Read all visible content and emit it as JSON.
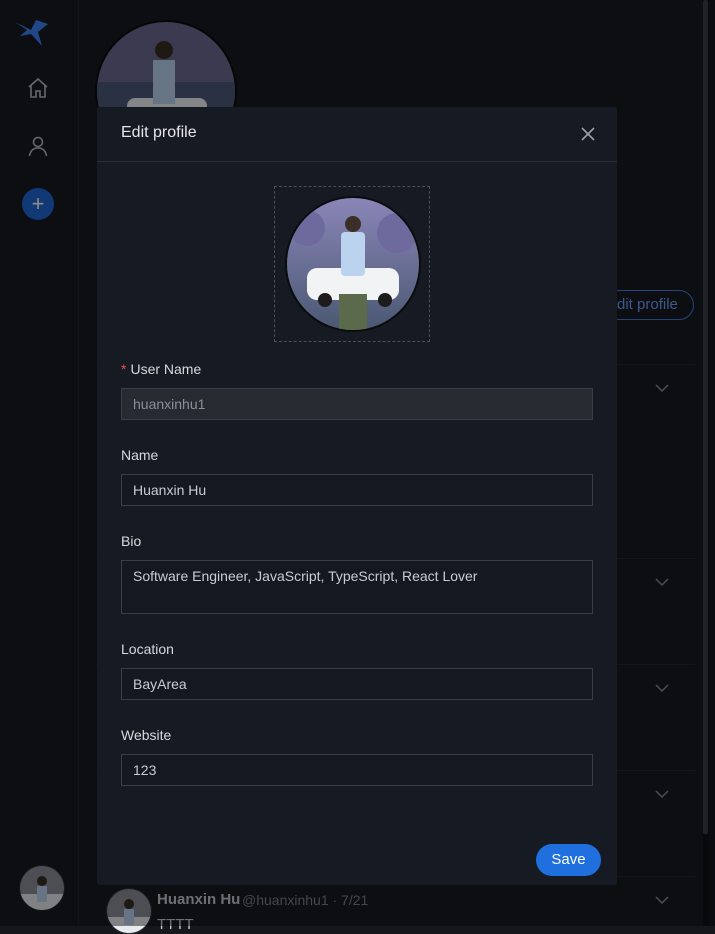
{
  "modal": {
    "title": "Edit profile",
    "fields": {
      "username": {
        "label": "User Name",
        "required": true,
        "value": "huanxinhu1",
        "disabled": true
      },
      "name": {
        "label": "Name",
        "value": "Huanxin Hu"
      },
      "bio": {
        "label": "Bio",
        "value": "Software Engineer, JavaScript, TypeScript, React Lover"
      },
      "location": {
        "label": "Location",
        "value": "BayArea"
      },
      "website": {
        "label": "Website",
        "value": "123"
      }
    },
    "save_label": "Save"
  },
  "profile": {
    "edit_button_label": "Edit profile"
  },
  "tweet": {
    "name": "Huanxin Hu",
    "meta": "@huanxinhu1 · 7/21",
    "text": "TTTT"
  },
  "colors": {
    "accent": "#1f6fde",
    "background": "#15171c",
    "modal": "#161a22"
  },
  "icons": [
    "bird-logo-icon",
    "home-icon",
    "user-icon",
    "plus-icon",
    "close-icon",
    "chevron-down-icon"
  ]
}
